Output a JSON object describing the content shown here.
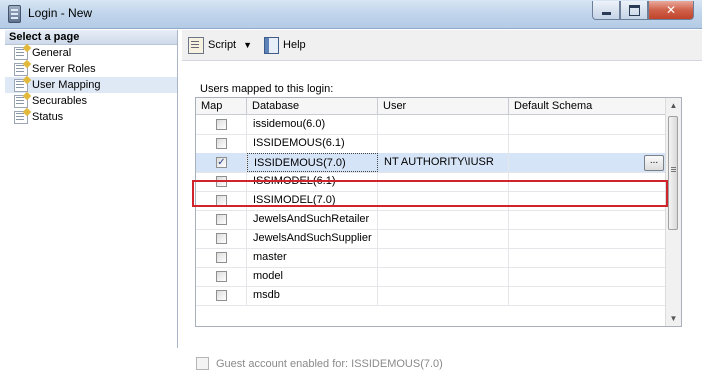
{
  "window": {
    "title": "Login - New",
    "controls": {
      "minimize": "minimize-icon",
      "maximize": "maximize-icon",
      "close": "close-icon"
    }
  },
  "sidebar": {
    "header": "Select a page",
    "items": [
      {
        "label": "General",
        "selected": false
      },
      {
        "label": "Server Roles",
        "selected": false
      },
      {
        "label": "User Mapping",
        "selected": true
      },
      {
        "label": "Securables",
        "selected": false
      },
      {
        "label": "Status",
        "selected": false
      }
    ]
  },
  "toolbar": {
    "script_label": "Script",
    "help_label": "Help"
  },
  "mapping": {
    "label": "Users mapped to this login:",
    "columns": [
      "Map",
      "Database",
      "User",
      "Default Schema"
    ],
    "rows": [
      {
        "map": false,
        "database": "issidemou(6.0)",
        "user": "",
        "schema": ""
      },
      {
        "map": false,
        "database": "ISSIDEMOUS(6.1)",
        "user": "",
        "schema": ""
      },
      {
        "map": true,
        "database": "ISSIDEMOUS(7.0)",
        "user": "NT AUTHORITY\\IUSR",
        "schema": "",
        "selected": true
      },
      {
        "map": false,
        "database": "ISSIMODEL(6.1)",
        "user": "",
        "schema": ""
      },
      {
        "map": false,
        "database": "ISSIMODEL(7.0)",
        "user": "",
        "schema": ""
      },
      {
        "map": false,
        "database": "JewelsAndSuchRetailer",
        "user": "",
        "schema": ""
      },
      {
        "map": false,
        "database": "JewelsAndSuchSupplier",
        "user": "",
        "schema": ""
      },
      {
        "map": false,
        "database": "master",
        "user": "",
        "schema": ""
      },
      {
        "map": false,
        "database": "model",
        "user": "",
        "schema": ""
      },
      {
        "map": false,
        "database": "msdb",
        "user": "",
        "schema": ""
      }
    ],
    "ellipsis_label": "..."
  },
  "guest": {
    "label": "Guest account enabled for: ISSIDEMOUS(7.0)",
    "checked": false,
    "enabled": false
  },
  "colors": {
    "highlight_border": "#d0232c",
    "selected_row": "#d6e4f7"
  }
}
